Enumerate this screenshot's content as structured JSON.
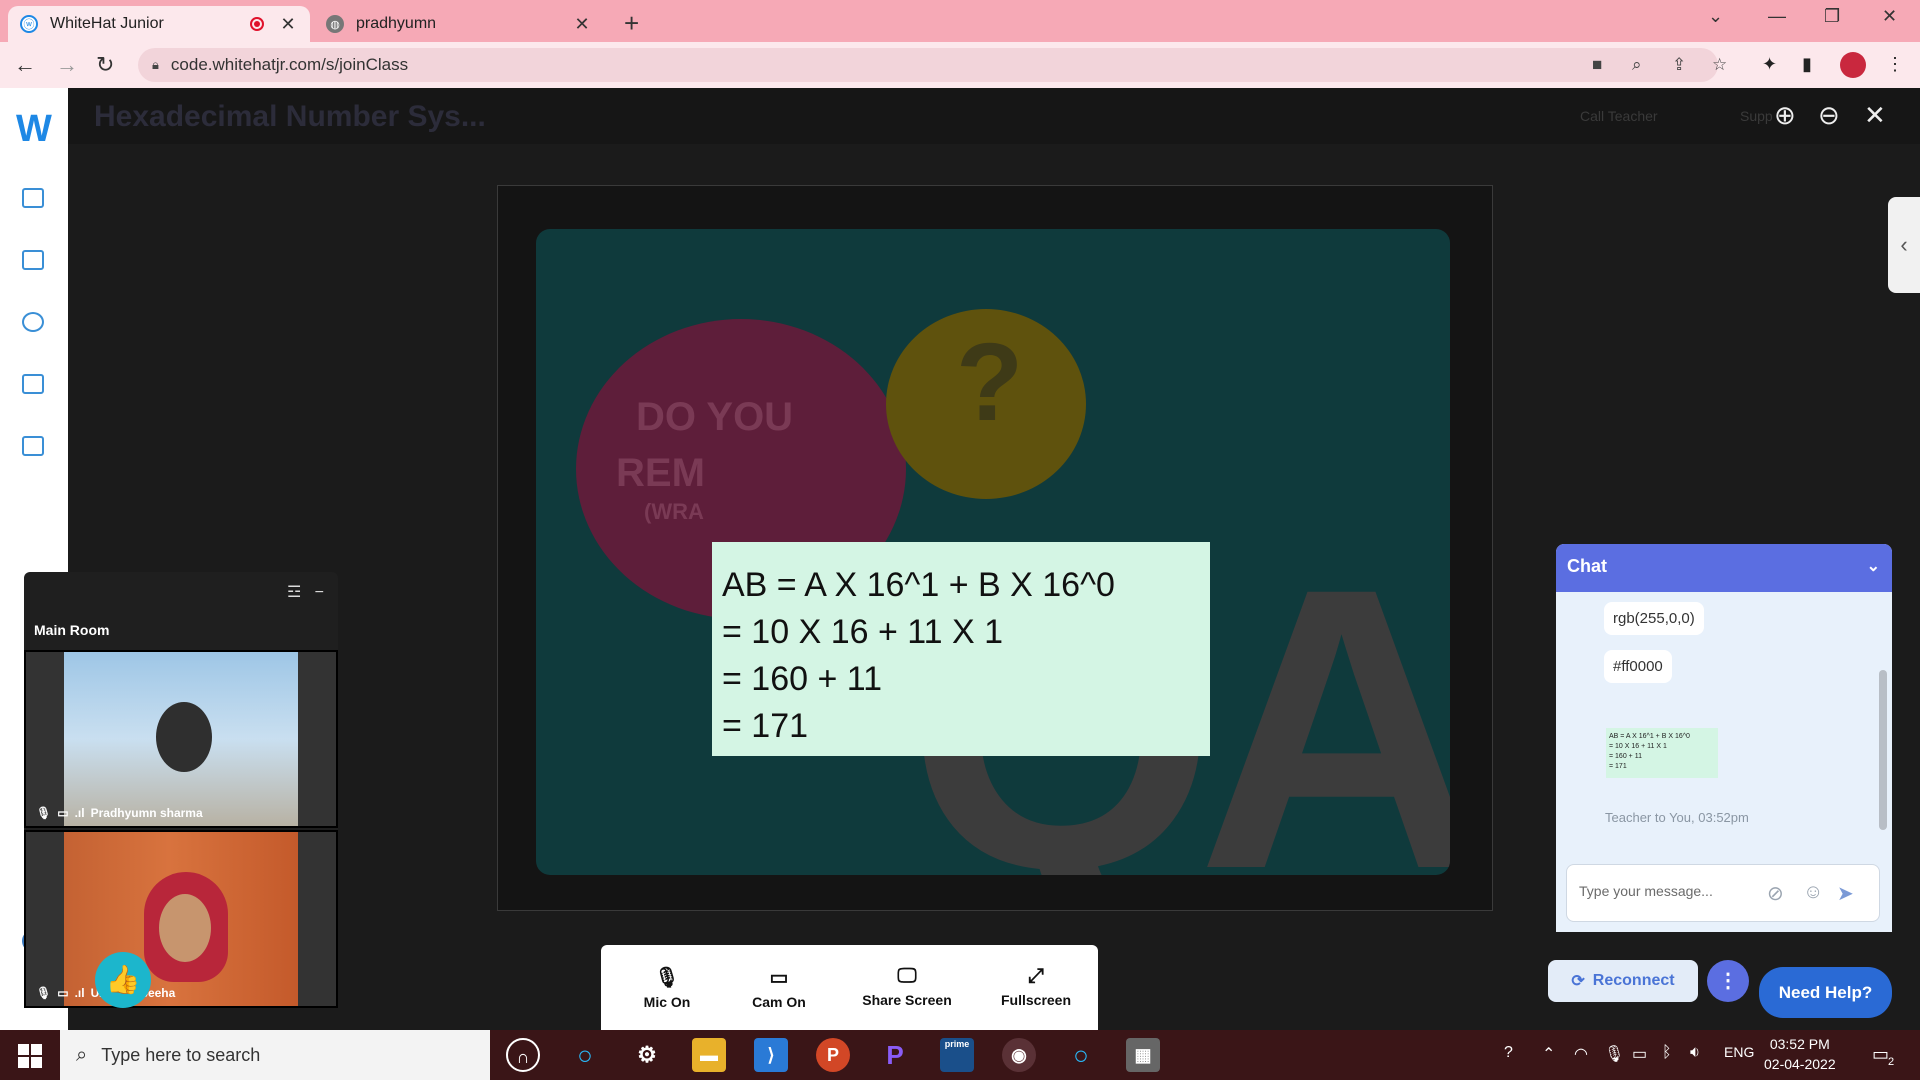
{
  "browser": {
    "tabs": [
      {
        "title": "WhiteHat Junior",
        "active": true
      },
      {
        "title": "pradhyumn",
        "active": false
      }
    ],
    "url": "code.whitehatjr.com/s/joinClass",
    "accent_color": "#f6a9b6"
  },
  "header": {
    "class_title": "Hexadecimal Number Sys...",
    "call_teacher": "Call Teacher",
    "support": "Supp"
  },
  "slide": {
    "title_text": "DO YOU",
    "title_line2": "REM",
    "subtitle": "(WRA",
    "qmark": "?",
    "qa": "QA",
    "math_lines": [
      "AB = A X 16^1 + B X 16^0",
      "= 10 X 16 + 11 X 1",
      "= 160 + 11",
      "= 171"
    ]
  },
  "video_panel": {
    "room_label": "Main Room",
    "participants": [
      {
        "name": "Pradhyumn sharma"
      },
      {
        "name": "Uzma Sabeeha"
      }
    ]
  },
  "chat": {
    "title": "Chat",
    "messages": [
      "rgb(255,0,0)",
      "#ff0000"
    ],
    "thumb_lines": [
      "AB = A X 16^1 + B X 16^0",
      "= 10 X 16 + 11 X 1",
      "= 160 + 11",
      "= 171"
    ],
    "meta": "Teacher to You, 03:52pm",
    "input_placeholder": "Type your message..."
  },
  "controls": {
    "mic": "Mic On",
    "cam": "Cam On",
    "share": "Share Screen",
    "fullscreen": "Fullscreen",
    "reconnect": "Reconnect",
    "need_help": "Need Help?"
  },
  "taskbar": {
    "search_placeholder": "Type here to search",
    "language": "ENG",
    "time": "03:52 PM",
    "date": "02-04-2022",
    "notification_count": "2"
  }
}
